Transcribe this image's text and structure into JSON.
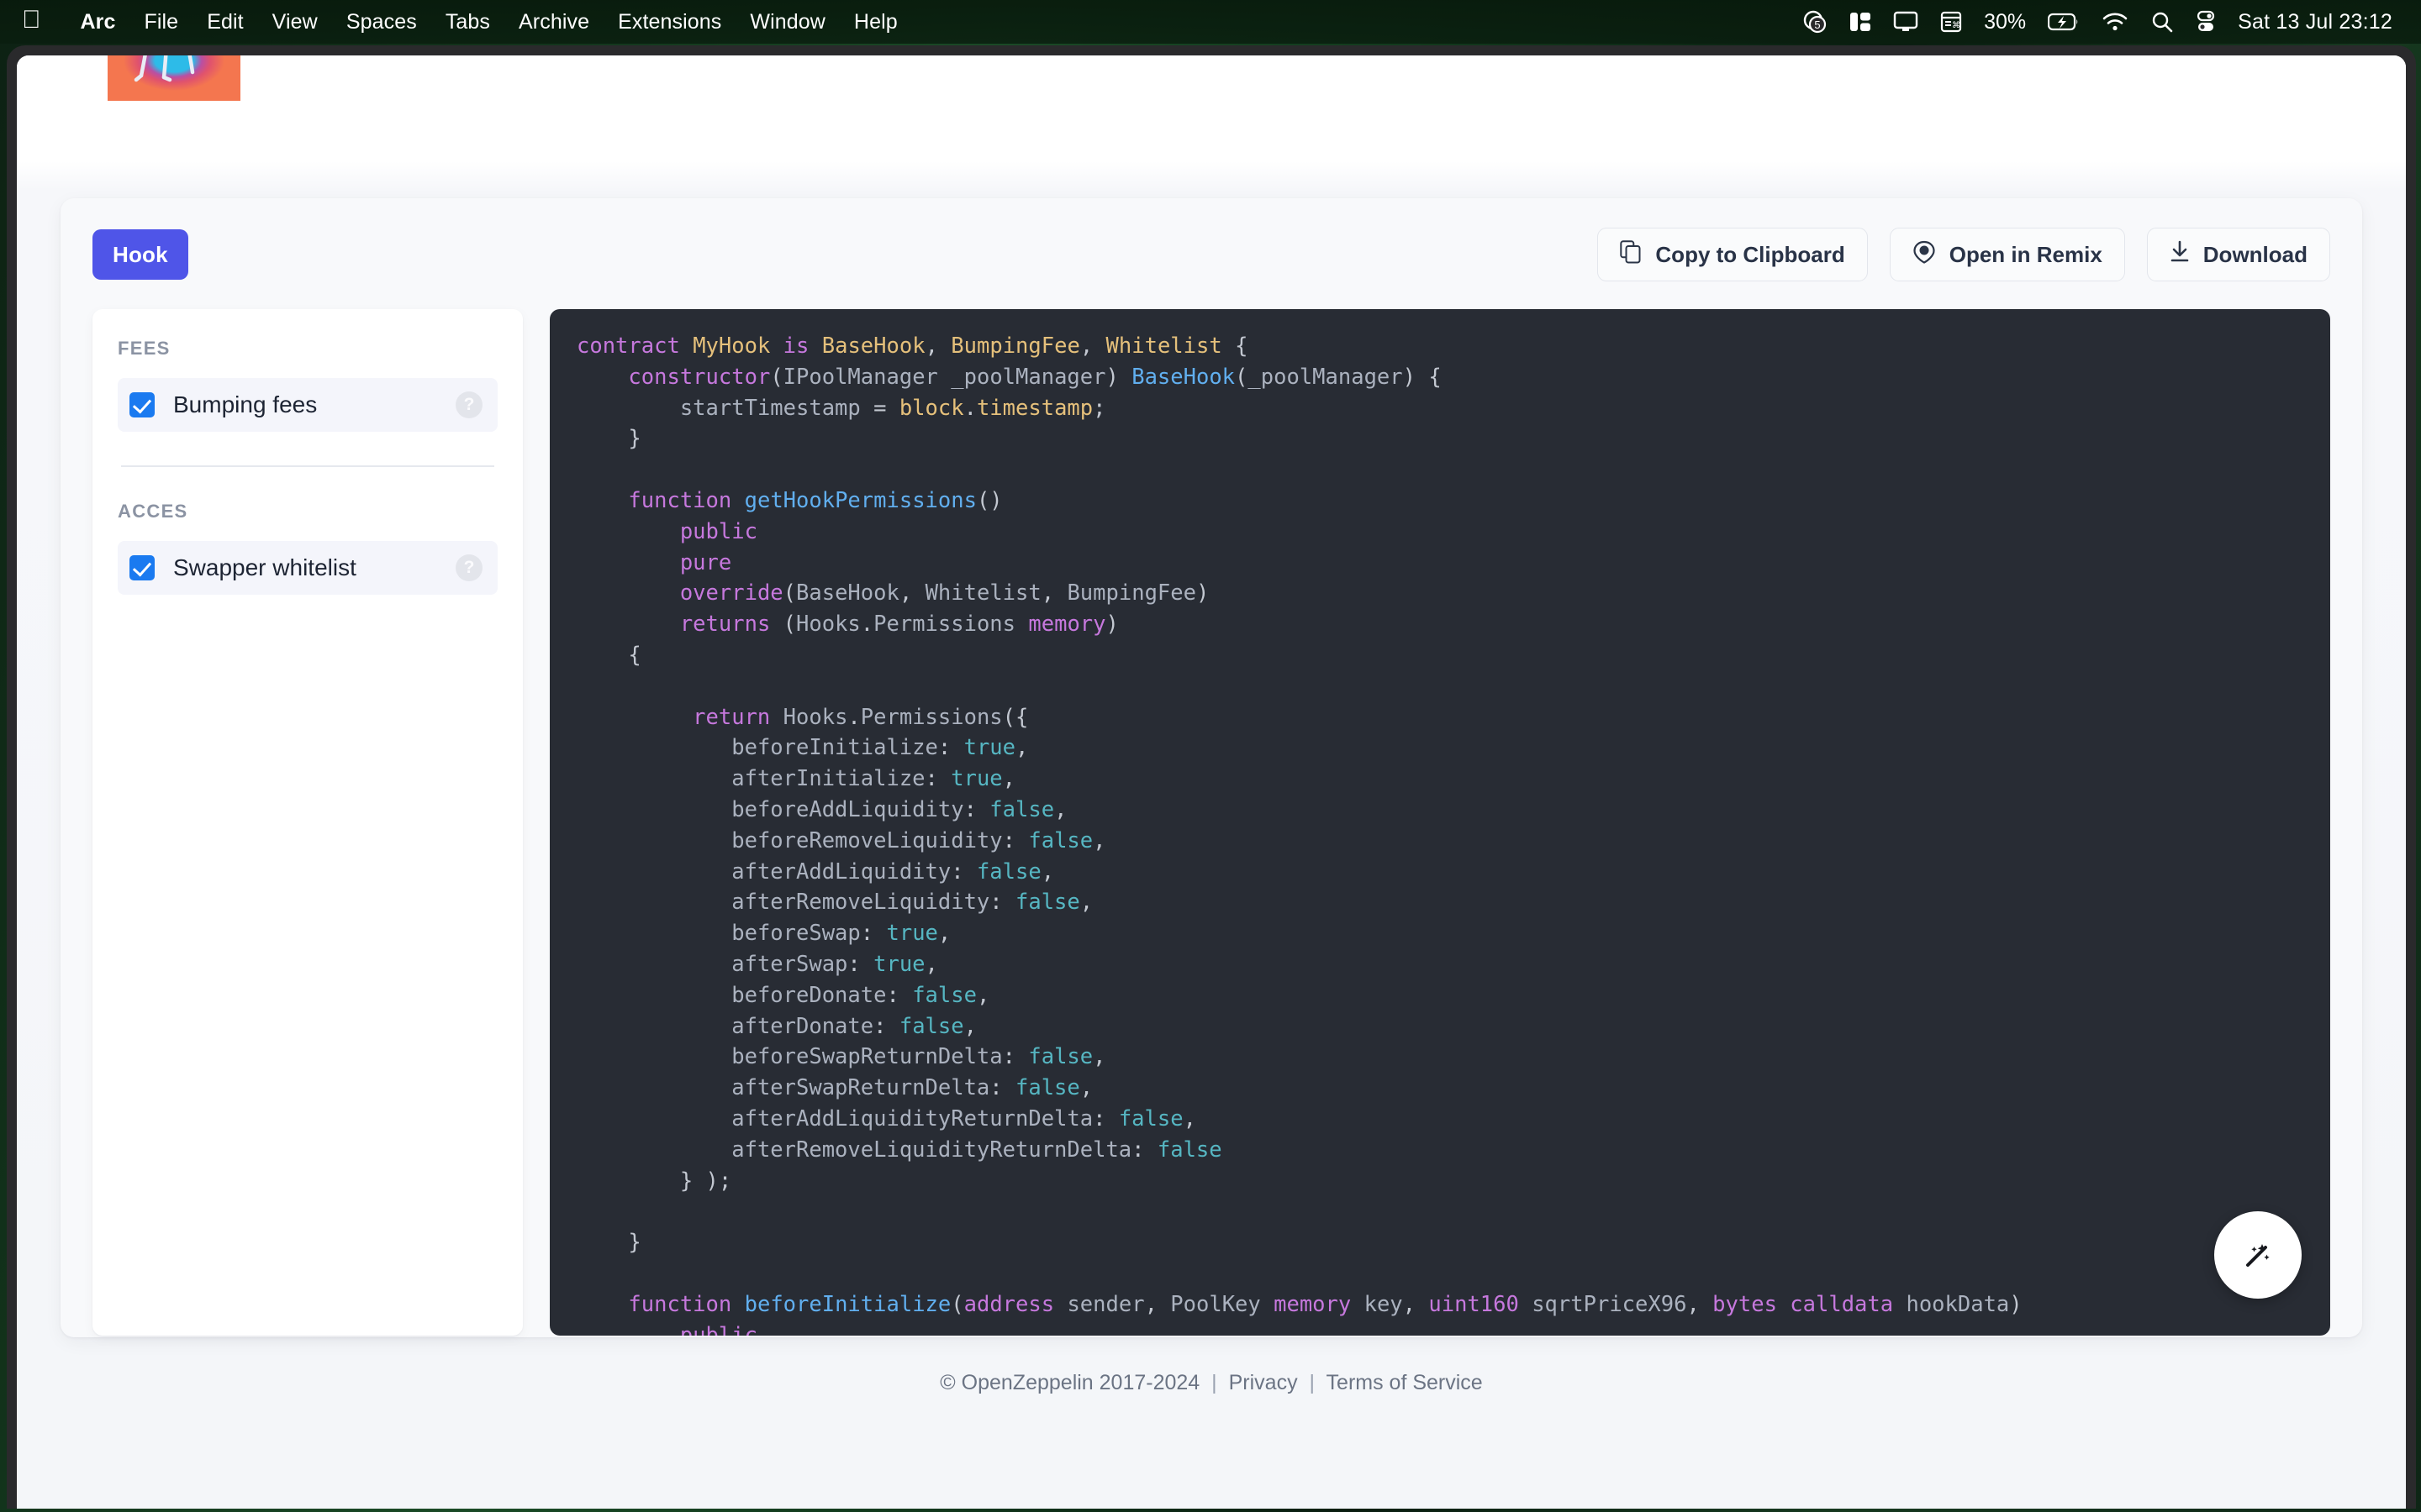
{
  "menubar": {
    "apple_glyph": "",
    "items": [
      {
        "label": "Arc",
        "bold": true
      },
      {
        "label": "File",
        "bold": false
      },
      {
        "label": "Edit",
        "bold": false
      },
      {
        "label": "View",
        "bold": false
      },
      {
        "label": "Spaces",
        "bold": false
      },
      {
        "label": "Tabs",
        "bold": false
      },
      {
        "label": "Archive",
        "bold": false
      },
      {
        "label": "Extensions",
        "bold": false
      },
      {
        "label": "Window",
        "bold": false
      },
      {
        "label": "Help",
        "bold": false
      }
    ],
    "status": {
      "badge_count": "5",
      "battery_percent": "30%",
      "clock": "Sat 13 Jul 23:12",
      "icons": [
        "cleanshot-icon",
        "split-view-icon",
        "display-icon",
        "shortcuts-icon",
        "battery-icon",
        "wifi-icon",
        "search-icon",
        "control-center-icon"
      ]
    }
  },
  "toolbar": {
    "hook_label": "Hook",
    "copy_label": "Copy to Clipboard",
    "remix_label": "Open in Remix",
    "download_label": "Download"
  },
  "sidebar": {
    "groups": [
      {
        "title": "FEES",
        "options": [
          {
            "label": "Bumping fees",
            "checked": true,
            "help": "?"
          }
        ]
      },
      {
        "title": "ACCES",
        "options": [
          {
            "label": "Swapper whitelist",
            "checked": true,
            "help": "?"
          }
        ]
      }
    ]
  },
  "code": {
    "language": "solidity",
    "lines": [
      "contract MyHook is BaseHook, BumpingFee, Whitelist {",
      "    constructor(IPoolManager _poolManager) BaseHook(_poolManager) {",
      "        startTimestamp = block.timestamp;",
      "    }",
      "",
      "    function getHookPermissions()",
      "        public",
      "        pure",
      "        override(BaseHook, Whitelist, BumpingFee)",
      "        returns (Hooks.Permissions memory)",
      "    {",
      "",
      "         return Hooks.Permissions({",
      "            beforeInitialize: true,",
      "            afterInitialize: true,",
      "            beforeAddLiquidity: false,",
      "            beforeRemoveLiquidity: false,",
      "            afterAddLiquidity: false,",
      "            afterRemoveLiquidity: false,",
      "            beforeSwap: true,",
      "            afterSwap: true,",
      "            beforeDonate: false,",
      "            afterDonate: false,",
      "            beforeSwapReturnDelta: false,",
      "            afterSwapReturnDelta: false,",
      "            afterAddLiquidityReturnDelta: false,",
      "            afterRemoveLiquidityReturnDelta: false",
      "        } );",
      "",
      "    }",
      "",
      "    function beforeInitialize(address sender, PoolKey memory key, uint160 sqrtPriceX96, bytes calldata hookData)",
      "        public"
    ],
    "fab_icon": "magic-wand-icon"
  },
  "footer": {
    "copyright": "© OpenZeppelin 2017-2024",
    "privacy": "Privacy",
    "terms": "Terms of Service",
    "separator": "|"
  },
  "colors": {
    "accent": "#4f55e8",
    "checkbox": "#1a7af0",
    "code_bg": "#282c34",
    "keyword": "#c678dd",
    "type": "#e5c07b",
    "function": "#61afef",
    "boolean": "#56b6c2"
  }
}
